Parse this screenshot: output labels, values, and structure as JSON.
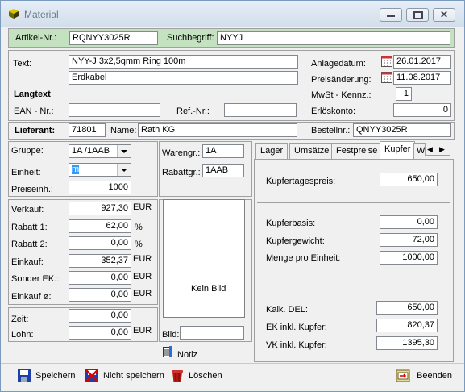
{
  "window": {
    "title": "Material"
  },
  "header": {
    "artikel_label": "Artikel-Nr.:",
    "artikel_value": "RQNYY3025R",
    "suchbegriff_label": "Suchbegriff:",
    "suchbegriff_value": "NYYJ"
  },
  "text": {
    "label": "Text:",
    "line1": "NYY-J  3x2,5qmm Ring 100m",
    "line2": "Erdkabel",
    "langtext_label": "Langtext",
    "ean_label": "EAN - Nr.:",
    "ean_value": "",
    "ref_label": "Ref.-Nr.:",
    "ref_value": ""
  },
  "right_info": {
    "anlagedatum_label": "Anlagedatum:",
    "anlagedatum_value": "26.01.2017",
    "preisaenderung_label": "Preisänderung:",
    "preisaenderung_value": "11.08.2017",
    "mwst_label": "MwSt - Kennz.:",
    "mwst_value": "1",
    "erloes_label": "Erlöskonto:",
    "erloes_value": "0"
  },
  "lieferant": {
    "label": "Lieferant:",
    "nr": "71801",
    "name_label": "Name:",
    "name_value": "Rath KG",
    "bestellnr_label": "Bestellnr.:",
    "bestellnr_value": "QNYY3025R"
  },
  "left": {
    "gruppe_label": "Gruppe:",
    "gruppe_value": "1A /1AAB",
    "einheit_label": "Einheit:",
    "einheit_value": "m",
    "preiseinh_label": "Preiseinh.:",
    "preiseinh_value": "1000",
    "verkauf_label": "Verkauf:",
    "verkauf_value": "927,30",
    "verkauf_unit": "EUR",
    "rabatt1_label": "Rabatt 1:",
    "rabatt1_value": "62,00",
    "rabatt1_unit": "%",
    "rabatt2_label": "Rabatt 2:",
    "rabatt2_value": "0,00",
    "rabatt2_unit": "%",
    "einkauf_label": "Einkauf:",
    "einkauf_value": "352,37",
    "einkauf_unit": "EUR",
    "sonder_label": "Sonder EK.:",
    "sonder_value": "0,00",
    "sonder_unit": "EUR",
    "einkaufo_label": "Einkauf ø:",
    "einkaufo_value": "0,00",
    "einkaufo_unit": "EUR",
    "zeit_label": "Zeit:",
    "zeit_value": "0,00",
    "lohn_label": "Lohn:",
    "lohn_value": "0,00",
    "lohn_unit": "EUR"
  },
  "middle": {
    "warengr_label": "Warengr.:",
    "warengr_value": "1A",
    "rabattgr_label": "Rabattgr.:",
    "rabattgr_value": "1AAB",
    "bild_placeholder": "Kein Bild",
    "bild_label": "Bild:",
    "bild_value": "",
    "notiz_label": "Notiz"
  },
  "tabs": [
    "Lager",
    "Umsätze",
    "Festpreise",
    "Kupfer",
    "W"
  ],
  "kupfer": {
    "tagespreis_label": "Kupfertagespreis:",
    "tagespreis_value": "650,00",
    "basis_label": "Kupferbasis:",
    "basis_value": "0,00",
    "gewicht_label": "Kupfergewicht:",
    "gewicht_value": "72,00",
    "menge_label": "Menge pro Einheit:",
    "menge_value": "1000,00",
    "del_label": "Kalk. DEL:",
    "del_value": "650,00",
    "ek_label": "EK inkl. Kupfer:",
    "ek_value": "820,37",
    "vk_label": "VK inkl. Kupfer:",
    "vk_value": "1395,30"
  },
  "toolbar": {
    "speichern": "Speichern",
    "nicht_speichern": "Nicht speichern",
    "loeschen": "Löschen",
    "beenden": "Beenden"
  },
  "colors": {
    "header_bg": "#c4e2bf",
    "lieferant_bg": "#ffffff",
    "panel_bg": "#f0f0f0"
  }
}
